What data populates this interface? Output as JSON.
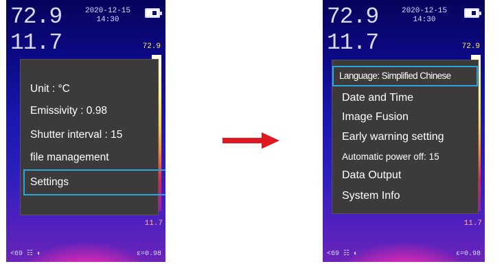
{
  "left": {
    "temp_max": "72.9",
    "temp_min": "11.7",
    "date": "2020-12-15",
    "time": "14:30",
    "scale_top": "72.9",
    "scale_bottom": "11.7",
    "status_left": "<69 ☷ ◐",
    "status_right": "ε=0.98",
    "menu": [
      "Unit : °C",
      "Emissivity : 0.98",
      "Shutter interval : 15",
      "file management",
      "Settings"
    ]
  },
  "right": {
    "temp_max": "72.9",
    "temp_min": "11.7",
    "date": "2020-12-15",
    "time": "14:30",
    "scale_top": "72.9",
    "scale_bottom": "11.7",
    "status_left": "<69 ☷ ◐",
    "status_right": "ε=0.98",
    "menu": [
      "Language: Simplified Chinese",
      "Date and Time",
      "Image Fusion",
      "Early warning setting",
      "Automatic power off: 15",
      "Data Output",
      "System Info"
    ]
  },
  "icons": {
    "battery": "battery-icon",
    "arrow": "right-arrow-icon"
  },
  "colors": {
    "highlight": "#2aa6e0",
    "arrow": "#e01820",
    "menu_bg": "#3d3a3a"
  }
}
